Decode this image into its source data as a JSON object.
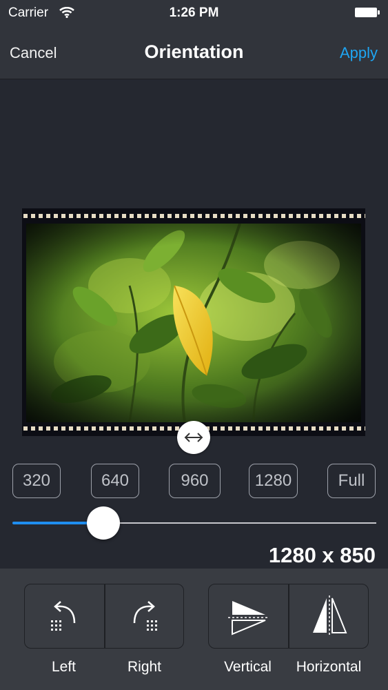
{
  "status_bar": {
    "carrier": "Carrier",
    "time": "1:26 PM"
  },
  "nav": {
    "cancel_label": "Cancel",
    "title": "Orientation",
    "apply_label": "Apply"
  },
  "size_presets": [
    "320",
    "640",
    "960",
    "1280",
    "Full"
  ],
  "slider": {
    "value_fraction": 0.25
  },
  "dimensions_text": "1280 x 850",
  "rotate": {
    "left_label": "Left",
    "right_label": "Right"
  },
  "flip": {
    "vertical_label": "Vertical",
    "horizontal_label": "Horizontal"
  },
  "colors": {
    "accent": "#1ea5f2",
    "slider_fill": "#1f8ef0",
    "background": "#252830",
    "toolbar": "#393c42"
  },
  "icons": [
    "wifi-icon",
    "battery-icon",
    "resize-arrows-icon",
    "rotate-left-icon",
    "rotate-right-icon",
    "flip-vertical-icon",
    "flip-horizontal-icon"
  ]
}
